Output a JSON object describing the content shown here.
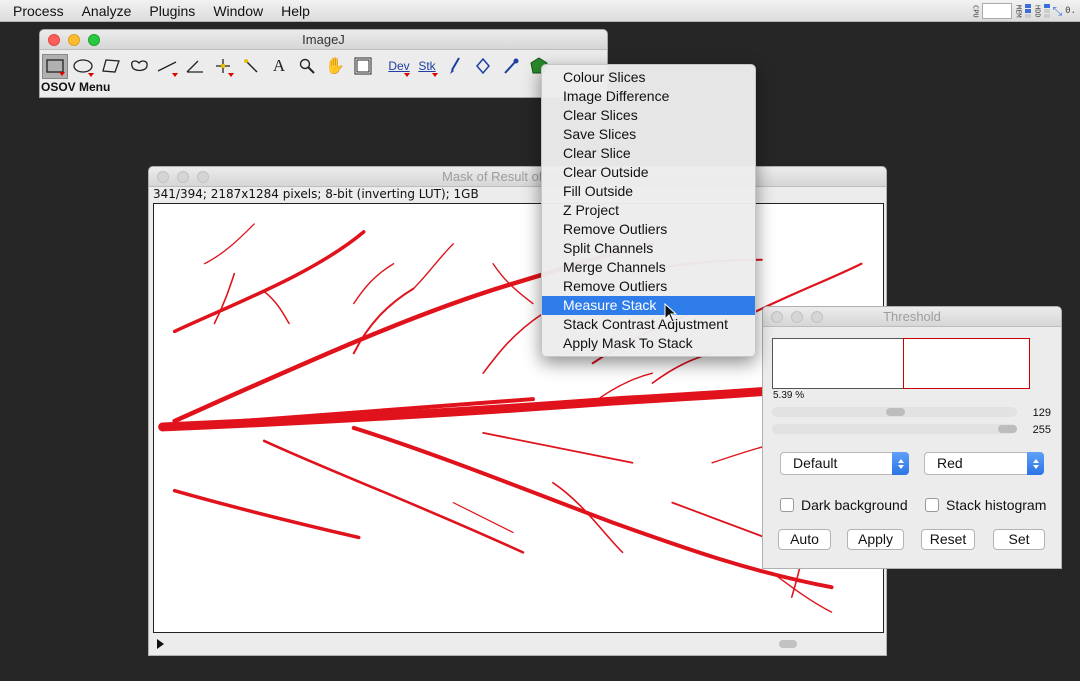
{
  "menubar": {
    "items": [
      "Process",
      "Analyze",
      "Plugins",
      "Window",
      "Help"
    ],
    "sysmon": {
      "cpu_label": "CPU",
      "mem_label": "MEM",
      "hdd_label": "HDD",
      "net_label": "0.",
      "icons": [
        "cpu-meter",
        "memory-meter",
        "disk-meter",
        "network-arrows"
      ]
    }
  },
  "imagej": {
    "title": "ImageJ",
    "tools": [
      "rectangle",
      "oval",
      "polygon",
      "freehand",
      "line",
      "angle",
      "point",
      "wand",
      "text",
      "magnifier",
      "hand",
      "color-picker"
    ],
    "macro_tools": {
      "dev": "Dev",
      "stk": "Stk"
    },
    "status": "OSOV Menu"
  },
  "image_window": {
    "title": "Mask of Result of Substac",
    "info": "341/394; 2187x1284 pixels; 8-bit (inverting LUT); 1GB"
  },
  "dropdown": {
    "items": [
      "Colour Slices",
      "Image Difference",
      "Clear Slices",
      "Save Slices",
      "Clear Slice",
      "Clear Outside",
      "Fill Outside",
      "Z Project",
      "Remove Outliers",
      "Split Channels",
      "Merge Channels",
      "Remove Outliers",
      "Measure Stack",
      "Stack Contrast Adjustment",
      "Apply Mask To Stack"
    ],
    "highlighted": "Measure Stack"
  },
  "threshold": {
    "title": "Threshold",
    "percent": "5.39 %",
    "lower_value": "129",
    "upper_value": "255",
    "method": "Default",
    "display": "Red",
    "dark_background_label": "Dark background",
    "stack_histogram_label": "Stack histogram",
    "dark_background_checked": false,
    "stack_histogram_checked": false,
    "buttons": {
      "auto": "Auto",
      "apply": "Apply",
      "reset": "Reset",
      "set": "Set"
    }
  },
  "colors": {
    "accent": "#2f7dea",
    "mask_red": "#e0121c",
    "background": "#262626"
  }
}
